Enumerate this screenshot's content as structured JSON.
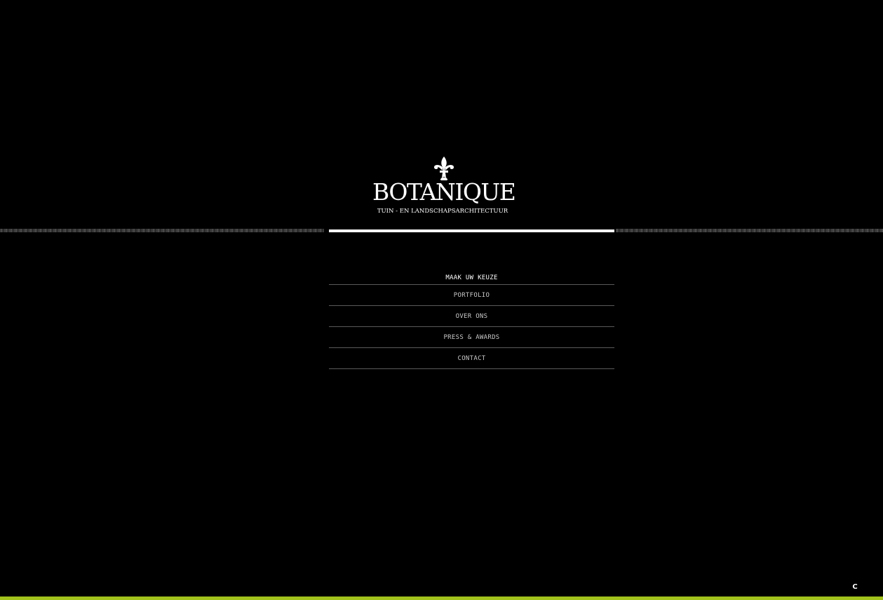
{
  "brand": {
    "name": "BOTANIQUE",
    "tagline": "TUIN - EN LANDSCHAPSARCHITECTUUR",
    "logo_icon": "fleur-de-lis-icon"
  },
  "menu": {
    "title": "MAAK UW KEUZE",
    "items": [
      {
        "label": "PORTFOLIO"
      },
      {
        "label": "OVER ONS"
      },
      {
        "label": "PRESS & AWARDS"
      },
      {
        "label": "CONTACT"
      }
    ]
  },
  "footer": {
    "icon": "c-logo-icon",
    "icon_glyph": "C",
    "accent_color": "#a2c31c"
  },
  "colors": {
    "background": "#000000",
    "text": "#ffffff",
    "accent": "#a2c31c"
  }
}
